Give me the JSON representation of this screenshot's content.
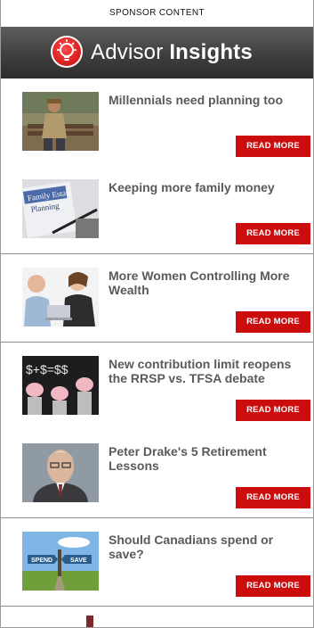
{
  "sponsor_label": "SPONSOR CONTENT",
  "brand": {
    "name_light": "Advisor",
    "name_bold": "Insights",
    "logo_icon": "lightbulb-icon",
    "accent": "#cc0d0d"
  },
  "articles": [
    {
      "title": "Millennials need planning too",
      "cta": "READ MORE",
      "image": "man-on-bench-image"
    },
    {
      "title": "Keeping more family money",
      "cta": "READ MORE",
      "image": "family-estate-planning-image"
    },
    {
      "title": "More Women Controlling More Wealth",
      "cta": "READ MORE",
      "image": "advisor-meeting-image"
    },
    {
      "title": "New contribution limit reopens the RRSP vs. TFSA debate",
      "cta": "READ MORE",
      "image": "piggy-banks-image"
    },
    {
      "title": "Peter Drake's 5 Retirement Lessons",
      "cta": "READ MORE",
      "image": "peter-drake-portrait-image"
    },
    {
      "title": "Should Canadians spend or save?",
      "cta": "READ MORE",
      "image": "spend-save-signs-image"
    }
  ]
}
